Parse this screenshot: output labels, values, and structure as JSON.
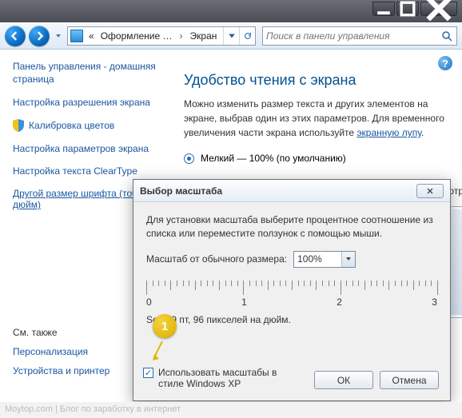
{
  "window": {
    "minimize": "–",
    "maximize": "▢",
    "close": "✕"
  },
  "nav": {
    "breadcrumb_prefix": "«",
    "breadcrumb1": "Оформление …",
    "sep": "›",
    "breadcrumb2": "Экран",
    "search_placeholder": "Поиск в панели управления"
  },
  "sidebar": {
    "header": "Панель управления - домашняя страница",
    "items": [
      "Настройка разрешения экрана",
      "Калибровка цветов",
      "Настройка параметров экрана",
      "Настройка текста ClearType",
      "Другой размер шрифта (точек на дюйм)"
    ],
    "seealso_title": "См. также",
    "seealso": [
      "Персонализация",
      "Устройства и принтер"
    ]
  },
  "main": {
    "title": "Удобство чтения с экрана",
    "desc_pre": "Можно изменить размер текста и других элементов на экране, выбрав один из этих параметров. Для временного увеличения части экрана используйте ",
    "desc_link": "экранную лупу",
    "desc_post": ".",
    "opt1": "Мелкий — 100% (по умолчанию)",
    "preview_label": "Просмотр"
  },
  "dialog": {
    "title": "Выбор масштаба",
    "intro": "Для установки масштаба выберите процентное соотношение из списка или переместите ползунок с помощью мыши.",
    "scale_label": "Масштаб от обычного размера:",
    "scale_value": "100%",
    "ruler": [
      "0",
      "1",
      "2",
      "3"
    ],
    "sample": "Sego        9 пт, 96 пикселей на дюйм.",
    "callout": "1",
    "checkbox": "Использовать масштабы в стиле Windows XP",
    "ok": "ОК",
    "cancel": "Отмена"
  },
  "footer": "Moytop.com | Блог по заработку в интернет"
}
